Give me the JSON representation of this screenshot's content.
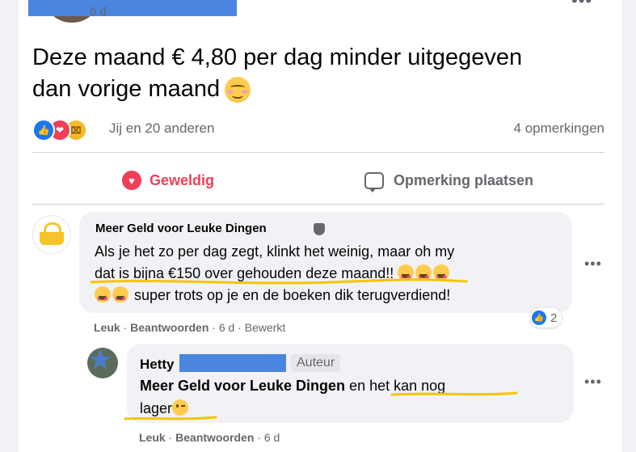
{
  "post": {
    "time": "6 d ·",
    "more": "•••",
    "text": "Deze maand € 4,80 per dag minder uitgegeven dan vorige maand",
    "reactions_text": "Jij en 20 anderen",
    "comments_count": "4 opmerkingen"
  },
  "actions": {
    "love": "Geweldig",
    "comment": "Opmerking plaatsen"
  },
  "comment1": {
    "author": "Meer Geld voor Leuke Dingen",
    "text_line1": "Als je het zo per dag zegt, klinkt het weinig, maar oh my",
    "text_line2": "dat is bijna €150 over gehouden deze maand!!",
    "text_line3": "super trots op je en de boeken dik terugverdiend!",
    "likes": "2",
    "like": "Leuk",
    "reply": "Beantwoorden",
    "time": "6 d",
    "edited": "Bewerkt",
    "more": "•••"
  },
  "comment2": {
    "author": "Hetty",
    "badge": "Auteur",
    "tag": "Meer Geld voor Leuke Dingen",
    "text_rest": " en het kan nog",
    "text_line2": "lager",
    "like": "Leuk",
    "reply": "Beantwoorden",
    "time": "6 d",
    "more": "•••"
  },
  "colors": {
    "redaction": "#4a86e0",
    "highlight_underline": "#f5c400",
    "love": "#f33e58",
    "like": "#1877f2"
  }
}
